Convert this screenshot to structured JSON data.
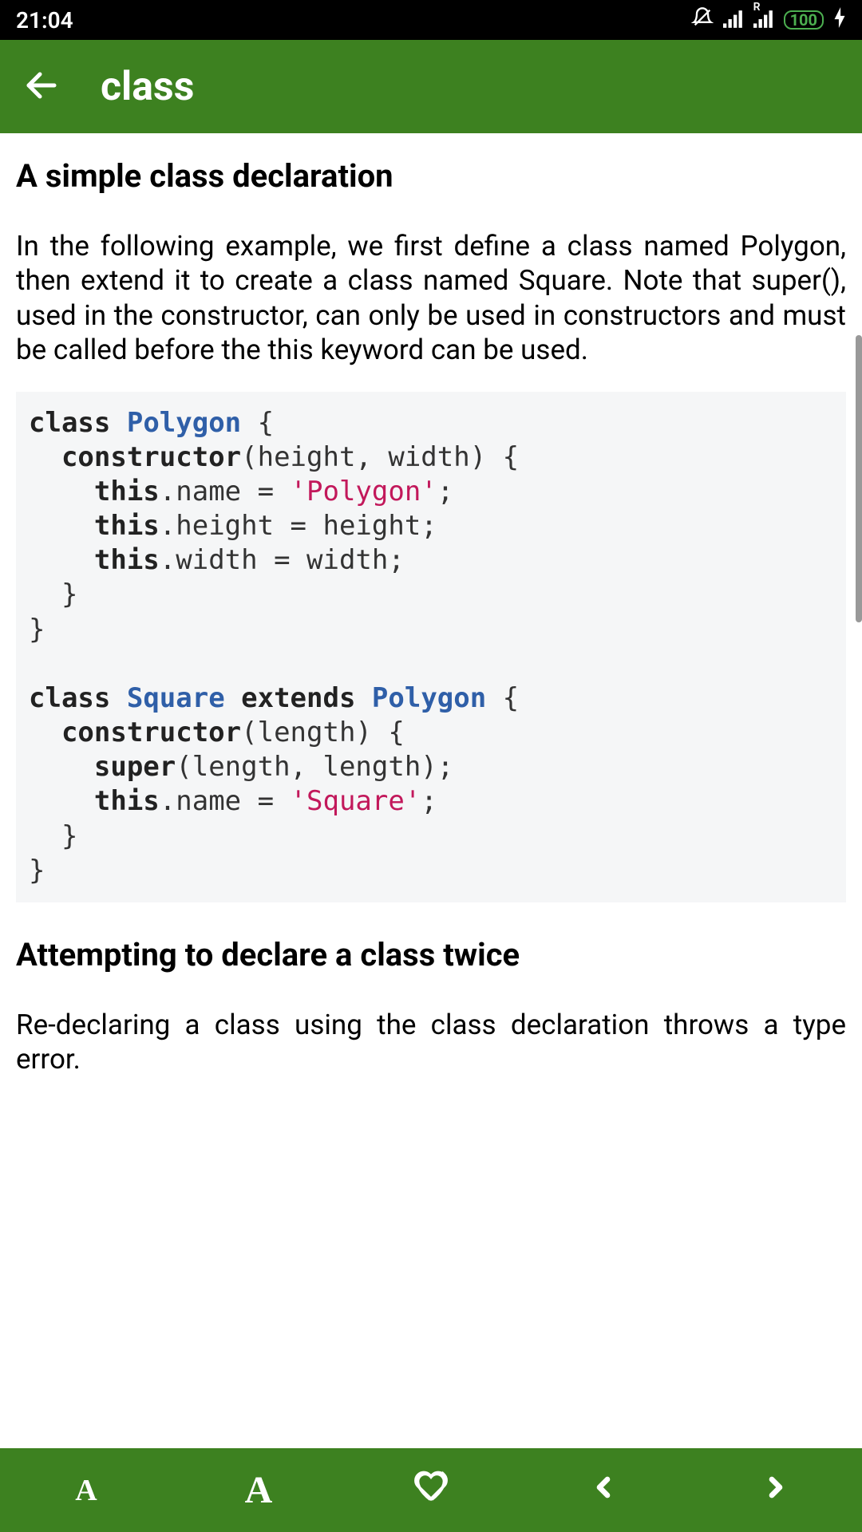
{
  "status": {
    "time": "21:04",
    "battery": "100"
  },
  "appbar": {
    "title": "class"
  },
  "content": {
    "heading1": "A simple class declaration",
    "para1": "In the following example, we first define a class named Polygon, then extend it to create a class named Square. Note that super(), used in the constructor, can only be used in constructors and must be called before the this keyword can be used.",
    "code": {
      "kw_class1": "class",
      "cls_poly": "Polygon",
      "brace_open1": " {",
      "indent2_ctor1": "  ",
      "ctor1": "constructor",
      "ctor1_args": "(height, width) {",
      "indent4_l1": "    ",
      "this1": "this",
      "l1_mid": ".name = ",
      "str_poly": "'Polygon'",
      "l1_end": ";",
      "indent4_l2": "    ",
      "this2": "this",
      "l2_rest": ".height = height;",
      "indent4_l3": "    ",
      "this3": "this",
      "l3_rest": ".width = width;",
      "indent2_close1": "  }",
      "close1": "}",
      "blank": "",
      "kw_class2": "class",
      "cls_square": "Square",
      "kw_extends": " extends ",
      "cls_poly2": "Polygon",
      "brace_open2": " {",
      "indent2_ctor2": "  ",
      "ctor2": "constructor",
      "ctor2_args": "(length) {",
      "indent4_s1": "    ",
      "super": "super",
      "super_args": "(length, length);",
      "indent4_s2": "    ",
      "this4": "this",
      "s2_mid": ".name = ",
      "str_square": "'Square'",
      "s2_end": ";",
      "indent2_close2": "  }",
      "close2": "}"
    },
    "heading2": "Attempting to declare a class twice",
    "para2": "Re-declaring a class using the class declaration throws a type error."
  },
  "bottombar": {
    "small_a": "A",
    "big_a": "A"
  }
}
